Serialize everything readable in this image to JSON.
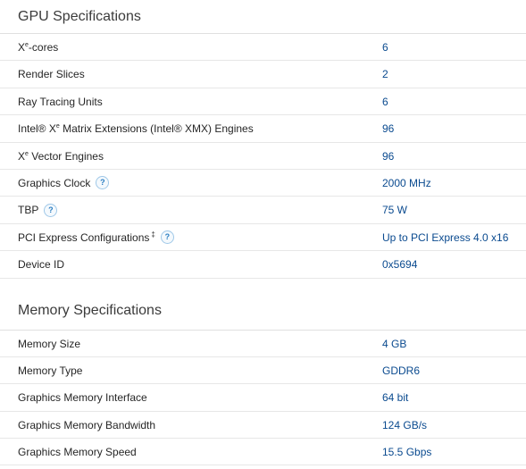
{
  "gpu_section": {
    "title": "GPU Specifications",
    "rows": [
      {
        "label_main": "X",
        "label_sup": "e",
        "label_rest": "-cores",
        "value": "6"
      },
      {
        "label": "Render Slices",
        "value": "2"
      },
      {
        "label": "Ray Tracing Units",
        "value": "6"
      },
      {
        "label": "Intel® Xe Matrix Extensions (Intel® XMX) Engines",
        "value": "96"
      },
      {
        "label_main": "X",
        "label_sup": "e",
        "label_rest": " Vector Engines",
        "value": "96"
      },
      {
        "label": "Graphics Clock",
        "value": "2000 MHz",
        "help": "?"
      },
      {
        "label": "TBP",
        "value": "75 W",
        "help": "?"
      },
      {
        "label": "PCI Express Configurations",
        "dagger": "‡",
        "value": "Up to PCI Express 4.0 x16",
        "help": "?"
      },
      {
        "label": "Device ID",
        "value": "0x5694"
      }
    ],
    "xmx_label_parts": {
      "part1": "Intel® X",
      "sup": "e",
      "part2": " Matrix Extensions (Intel® XMX) Engines"
    }
  },
  "memory_section": {
    "title": "Memory Specifications",
    "rows": [
      {
        "label": "Memory Size",
        "value": "4 GB"
      },
      {
        "label": "Memory Type",
        "value": "GDDR6"
      },
      {
        "label": "Graphics Memory Interface",
        "value": "64 bit"
      },
      {
        "label": "Graphics Memory Bandwidth",
        "value": "124 GB/s"
      },
      {
        "label": "Graphics Memory Speed",
        "value": "15.5 Gbps"
      }
    ]
  },
  "colors": {
    "value_text": "#0a4a8f",
    "help_icon": "#2b7ec2",
    "divider": "#e7e7e7"
  }
}
